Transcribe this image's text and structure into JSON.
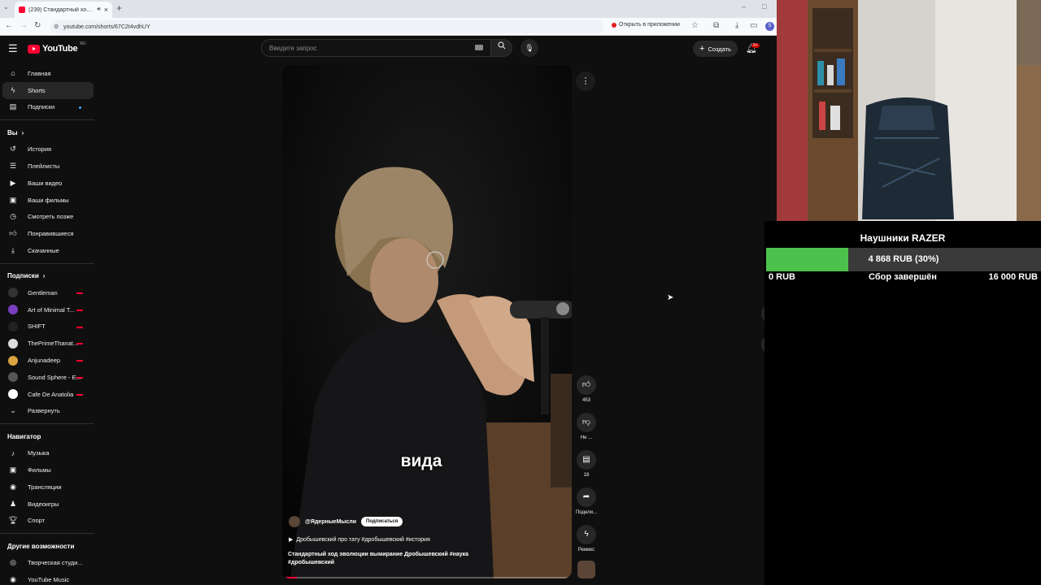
{
  "browser": {
    "tab_title": "(239) Стандартный ход эво...",
    "url": "youtube.com/shorts/67C2t4vdhUY",
    "open_in_app": "Открыть в приложении",
    "profile_initial": "S"
  },
  "header": {
    "logo_text": "YouTube",
    "logo_region": "RU",
    "search_placeholder": "Введите запрос",
    "create_label": "Создать",
    "notifications_badge": "9+"
  },
  "sidebar": {
    "main": [
      {
        "label": "Главная",
        "icon": "home-icon"
      },
      {
        "label": "Shorts",
        "icon": "shorts-icon",
        "active": true
      },
      {
        "label": "Подписки",
        "icon": "subscriptions-icon"
      }
    ],
    "you_title": "Вы",
    "you": [
      {
        "label": "История",
        "icon": "history-icon"
      },
      {
        "label": "Плейлисты",
        "icon": "playlists-icon"
      },
      {
        "label": "Ваши видео",
        "icon": "your-videos-icon"
      },
      {
        "label": "Ваши фильмы",
        "icon": "your-movies-icon"
      },
      {
        "label": "Смотреть позже",
        "icon": "watch-later-icon"
      },
      {
        "label": "Понравившиеся",
        "icon": "liked-icon"
      },
      {
        "label": "Скачанные",
        "icon": "downloads-icon"
      }
    ],
    "subs_title": "Подписки",
    "subs": [
      {
        "label": "Gentleman",
        "color": "#333333"
      },
      {
        "label": "Art of Minimal T...",
        "color": "#7a3fbf"
      },
      {
        "label": "SHIFT",
        "color": "#222222"
      },
      {
        "label": "ThePrimeThanat...",
        "color": "#dddddd"
      },
      {
        "label": "Anjunadeep",
        "color": "#d9a441"
      },
      {
        "label": "Sound Sphere - E...",
        "color": "#555555"
      },
      {
        "label": "Cafe De Anatolia",
        "color": "#ffffff"
      }
    ],
    "expand_label": "Развернуть",
    "navigator_title": "Навигатор",
    "navigator": [
      {
        "label": "Музыка",
        "icon": "music-icon"
      },
      {
        "label": "Фильмы",
        "icon": "movies-icon"
      },
      {
        "label": "Трансляции",
        "icon": "live-icon"
      },
      {
        "label": "Видеоигры",
        "icon": "gaming-icon"
      },
      {
        "label": "Спорт",
        "icon": "sport-icon"
      }
    ],
    "other_title": "Другие возможности",
    "other": [
      {
        "label": "Творческая студи...",
        "icon": "studio-icon"
      },
      {
        "label": "YouTube Music",
        "icon": "yt-music-icon"
      }
    ]
  },
  "video": {
    "subtitle": "вида",
    "channel": "@ЯдерныеМысли",
    "subscribe_label": "Подписаться",
    "related": "Дробышевский про тату #дробышевский #история",
    "description": "Стандартный ход эволюции  вымирание  Дробышевский #наука #дробышевский",
    "progress": 0.05
  },
  "actions": {
    "likes": "453",
    "dislike_label": "Не ...",
    "comments": "18",
    "share_label": "Подели...",
    "remix_label": "Ремикс"
  },
  "goal": {
    "title": "Наушники RAZER",
    "amount_text": "4 868 RUB (30%)",
    "fraction": 0.3,
    "min_label": "0 RUB",
    "status": "Сбор завершён",
    "max_label": "16 000 RUB"
  }
}
